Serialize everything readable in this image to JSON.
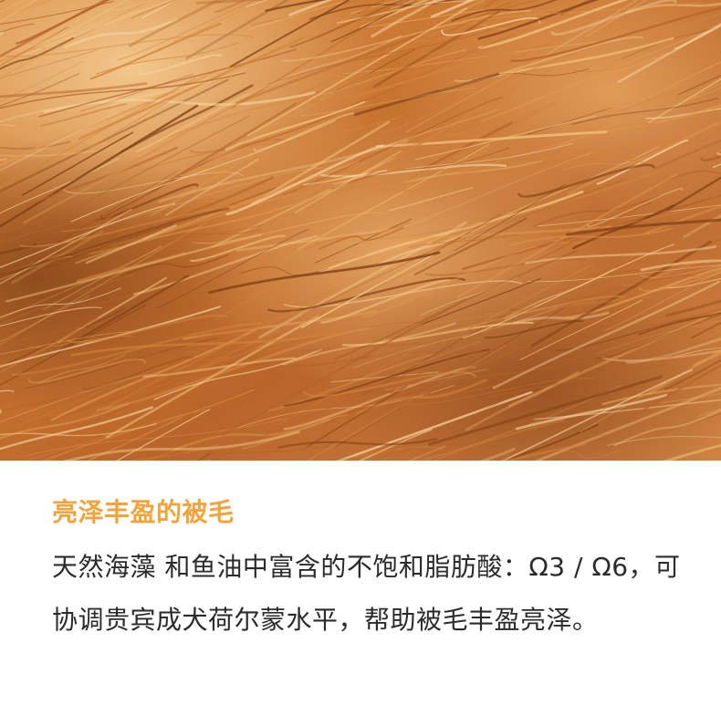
{
  "photo": {
    "subject_icon": "fur-texture-image"
  },
  "content": {
    "headline": "亮泽丰盈的被毛",
    "body": "天然海藻 和鱼油中富含的不饱和脂肪酸：Ω3 / Ω6，可协调贵宾成犬荷尔蒙水平，帮助被毛丰盈亮泽。"
  },
  "colors": {
    "headline": "#f2a43c",
    "body": "#2b2b2b",
    "fur_base": "#c9782f",
    "fur_highlight": "#f3c27e",
    "fur_shadow": "#7e3f14"
  }
}
